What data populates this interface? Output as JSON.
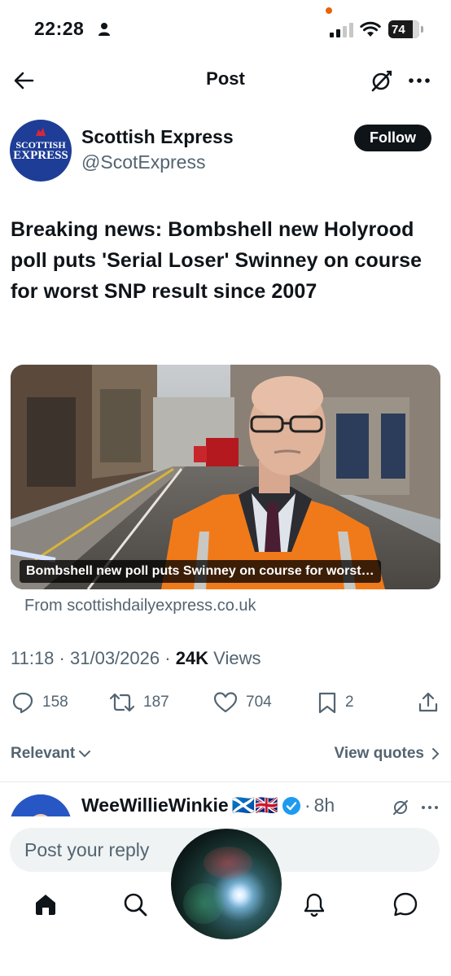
{
  "status_bar": {
    "time": "22:28",
    "battery": "74",
    "indicator_color": "#e8630a"
  },
  "header": {
    "title": "Post",
    "back_icon": "arrow-left-icon",
    "grok_icon": "grok-icon",
    "more_icon": "more-horizontal-icon"
  },
  "post": {
    "author": {
      "name": "Scottish Express",
      "handle": "@ScotExpress",
      "avatar_line1": "SCOTTISH",
      "avatar_line2": "EXPRESS",
      "avatar_color": "#1e3d96"
    },
    "follow_label": "Follow",
    "text": "Breaking news: Bombshell new Holyrood poll puts 'Serial Loser' Swinney on course for worst SNP result since 2007",
    "card": {
      "caption": "Bombshell new poll puts Swinney on course for worst…",
      "source": "From scottishdailyexpress.co.uk"
    },
    "meta": {
      "time": "11:18",
      "date": "31/03/2026",
      "views_count": "24K",
      "views_label": "Views"
    },
    "stats": {
      "replies": "158",
      "reposts": "187",
      "likes": "704",
      "bookmarks": "2"
    }
  },
  "sort": {
    "relevant_label": "Relevant",
    "view_quotes_label": "View quotes"
  },
  "reply_preview": {
    "name": "WeeWillieWinkie",
    "flags": "🏴󠁧󠁢󠁳󠁣󠁴󠁿🇬🇧",
    "time": "8h"
  },
  "composer": {
    "placeholder": "Post your reply"
  },
  "nav": {
    "items": [
      "home-icon",
      "search-icon",
      "notifications-icon",
      "messages-icon"
    ]
  }
}
